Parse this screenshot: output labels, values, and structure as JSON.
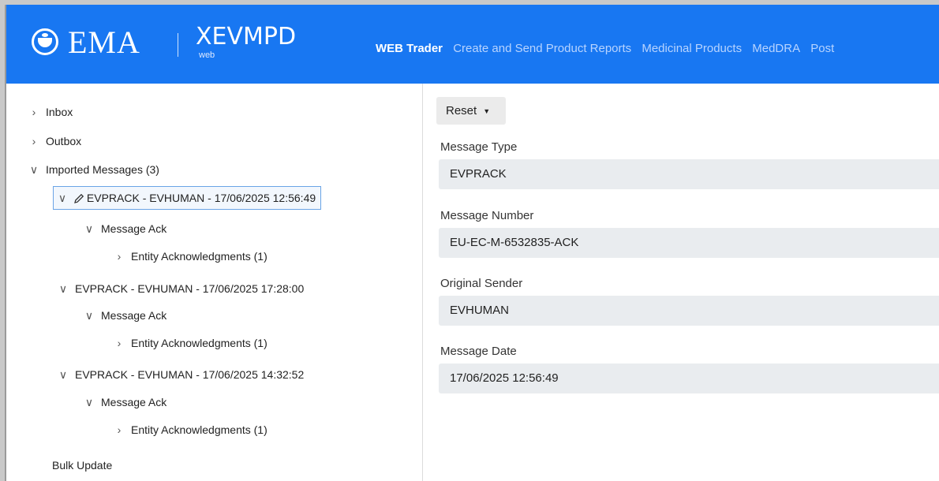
{
  "header": {
    "logo_text": "EMA",
    "app_name": "XEVMPD",
    "app_sub": "web",
    "nav": [
      "WEB Trader",
      "Create and Send Product Reports",
      "Medicinal Products",
      "MedDRA",
      "Post"
    ]
  },
  "sidebar": {
    "inbox": "Inbox",
    "outbox": "Outbox",
    "imported": "Imported Messages (3)",
    "messages": [
      {
        "title": "EVPRACK - EVHUMAN - 17/06/2025 12:56:49",
        "ack": "Message Ack",
        "entity": "Entity Acknowledgments (1)"
      },
      {
        "title": "EVPRACK - EVHUMAN - 17/06/2025 17:28:00",
        "ack": "Message Ack",
        "entity": "Entity Acknowledgments (1)"
      },
      {
        "title": "EVPRACK - EVHUMAN - 17/06/2025 14:32:52",
        "ack": "Message Ack",
        "entity": "Entity Acknowledgments (1)"
      }
    ],
    "bulk_update": "Bulk Update"
  },
  "content": {
    "reset_label": "Reset",
    "fields": [
      {
        "label": "Message Type",
        "value": "EVPRACK"
      },
      {
        "label": "Message Number",
        "value": "EU-EC-M-6532835-ACK"
      },
      {
        "label": "Original Sender",
        "value": "EVHUMAN"
      },
      {
        "label": "Message Date",
        "value": "17/06/2025 12:56:49"
      }
    ]
  },
  "colors": {
    "header_bg": "#1877f2",
    "selected_border": "#6aa4e6",
    "field_bg": "#e9ecef"
  },
  "icons": [
    "ema-logo-icon",
    "chevron-right-icon",
    "chevron-down-icon",
    "pencil-icon",
    "caret-down-icon"
  ]
}
